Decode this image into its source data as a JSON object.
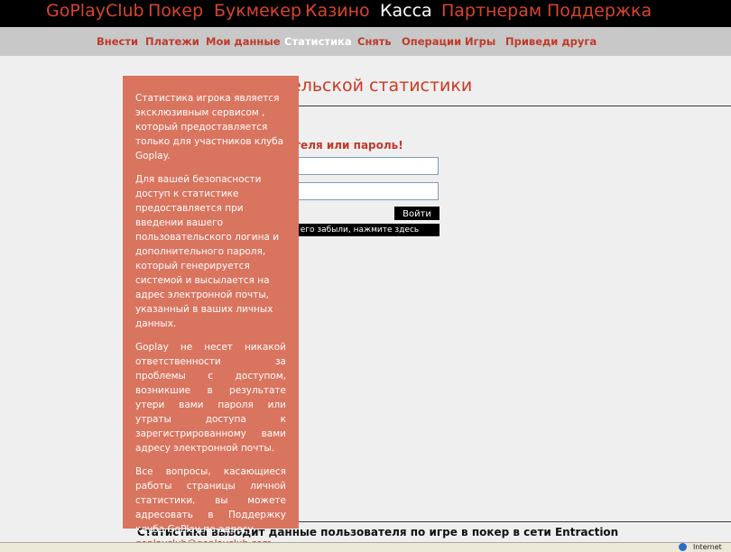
{
  "top_nav": {
    "items": [
      {
        "label": "GoPlayClub"
      },
      {
        "label": "Покер"
      },
      {
        "label": "Букмекер"
      },
      {
        "label": "Казино"
      },
      {
        "label": "Касса"
      },
      {
        "label": "Партнерам"
      },
      {
        "label": "Поддержка"
      }
    ],
    "active": "Касса"
  },
  "sub_nav": {
    "items": [
      {
        "label": "Внести"
      },
      {
        "label": "Платежи"
      },
      {
        "label": "Мои данные"
      },
      {
        "label": "Статистика"
      },
      {
        "label": "Снять"
      },
      {
        "label": "Операции"
      },
      {
        "label": "Игры"
      },
      {
        "label": "Приведи друга"
      }
    ],
    "active": "Статистика"
  },
  "main": {
    "title_partial": "ельской статистики",
    "error_partial": "ателя или пароль!",
    "login_button": "Войти",
    "forgot_partial": "и его забыли, нажмите здесь",
    "footer": "Статистика выводит данные пользователя по игре в покер в сети Entraction"
  },
  "info_panel": {
    "p1": "Статистика игрока является эксклюзивным сервисом , который предоставляется только для участников клуба Goplay.",
    "p2": "Для вашей безопасности доступ к статистике предоставляется при введении вашего пользовательского логина и дополнительного пароля, который генерируется системой и высылается на адрес электронной почты, указанный в ваших личных данных.",
    "p3": "Goplay не несет никакой ответственности за проблемы с доступом, возникшие в результате утери вами пароля или утраты доступа к зарегистрированному вами адресу электронной почты.",
    "p4": "Все вопросы, касающиеся работы страницы личной статистики, вы можете адресовать в Поддержку клуба GoPlay по адресу",
    "email": "goplayclub@goplayclub.com"
  },
  "status_bar": {
    "text": "Internet",
    "icon": "globe-icon"
  },
  "colors": {
    "accent": "#d8452b",
    "panel": "#d9745f",
    "topbar": "#000000",
    "subbar": "#c8c8c8"
  }
}
